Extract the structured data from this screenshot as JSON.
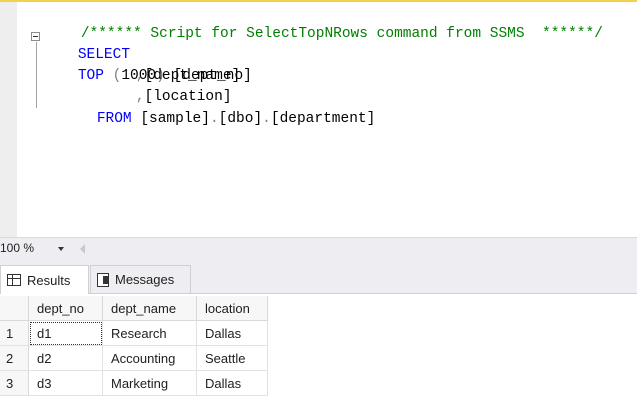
{
  "editor": {
    "comment": "/****** Script for SelectTopNRows command from SSMS  ******/",
    "line1_keyword_select": "SELECT",
    "line1_keyword_top": "TOP",
    "line1_paren_open": " (",
    "line1_number": "1000",
    "line1_paren_close": ")",
    "line1_column": " [dept_no]",
    "line2_comma": ",",
    "line2_column": "[dept_name]",
    "line3_comma": ",",
    "line3_column": "[location]",
    "line4_keyword_from": "FROM",
    "line4_db": " [sample]",
    "line4_dot1": ".",
    "line4_schema": "[dbo]",
    "line4_dot2": ".",
    "line4_table": "[department]"
  },
  "zoom": {
    "value": "100 %"
  },
  "tabs": {
    "results_label": "Results",
    "messages_label": "Messages"
  },
  "results": {
    "columns": [
      "dept_no",
      "dept_name",
      "location"
    ],
    "rows": [
      {
        "num": "1",
        "dept_no": "d1",
        "dept_name": "Research",
        "location": "Dallas"
      },
      {
        "num": "2",
        "dept_no": "d2",
        "dept_name": "Accounting",
        "location": "Seattle"
      },
      {
        "num": "3",
        "dept_no": "d3",
        "dept_name": "Marketing",
        "location": "Dallas"
      }
    ]
  },
  "colors": {
    "keyword": "#0000ff",
    "comment": "#008000",
    "operator": "#808080",
    "highlight_border": "#f2d24a"
  },
  "icons": [
    "collapse-icon",
    "grid-icon",
    "messages-icon",
    "dropdown-arrow-icon",
    "scroll-left-icon"
  ]
}
